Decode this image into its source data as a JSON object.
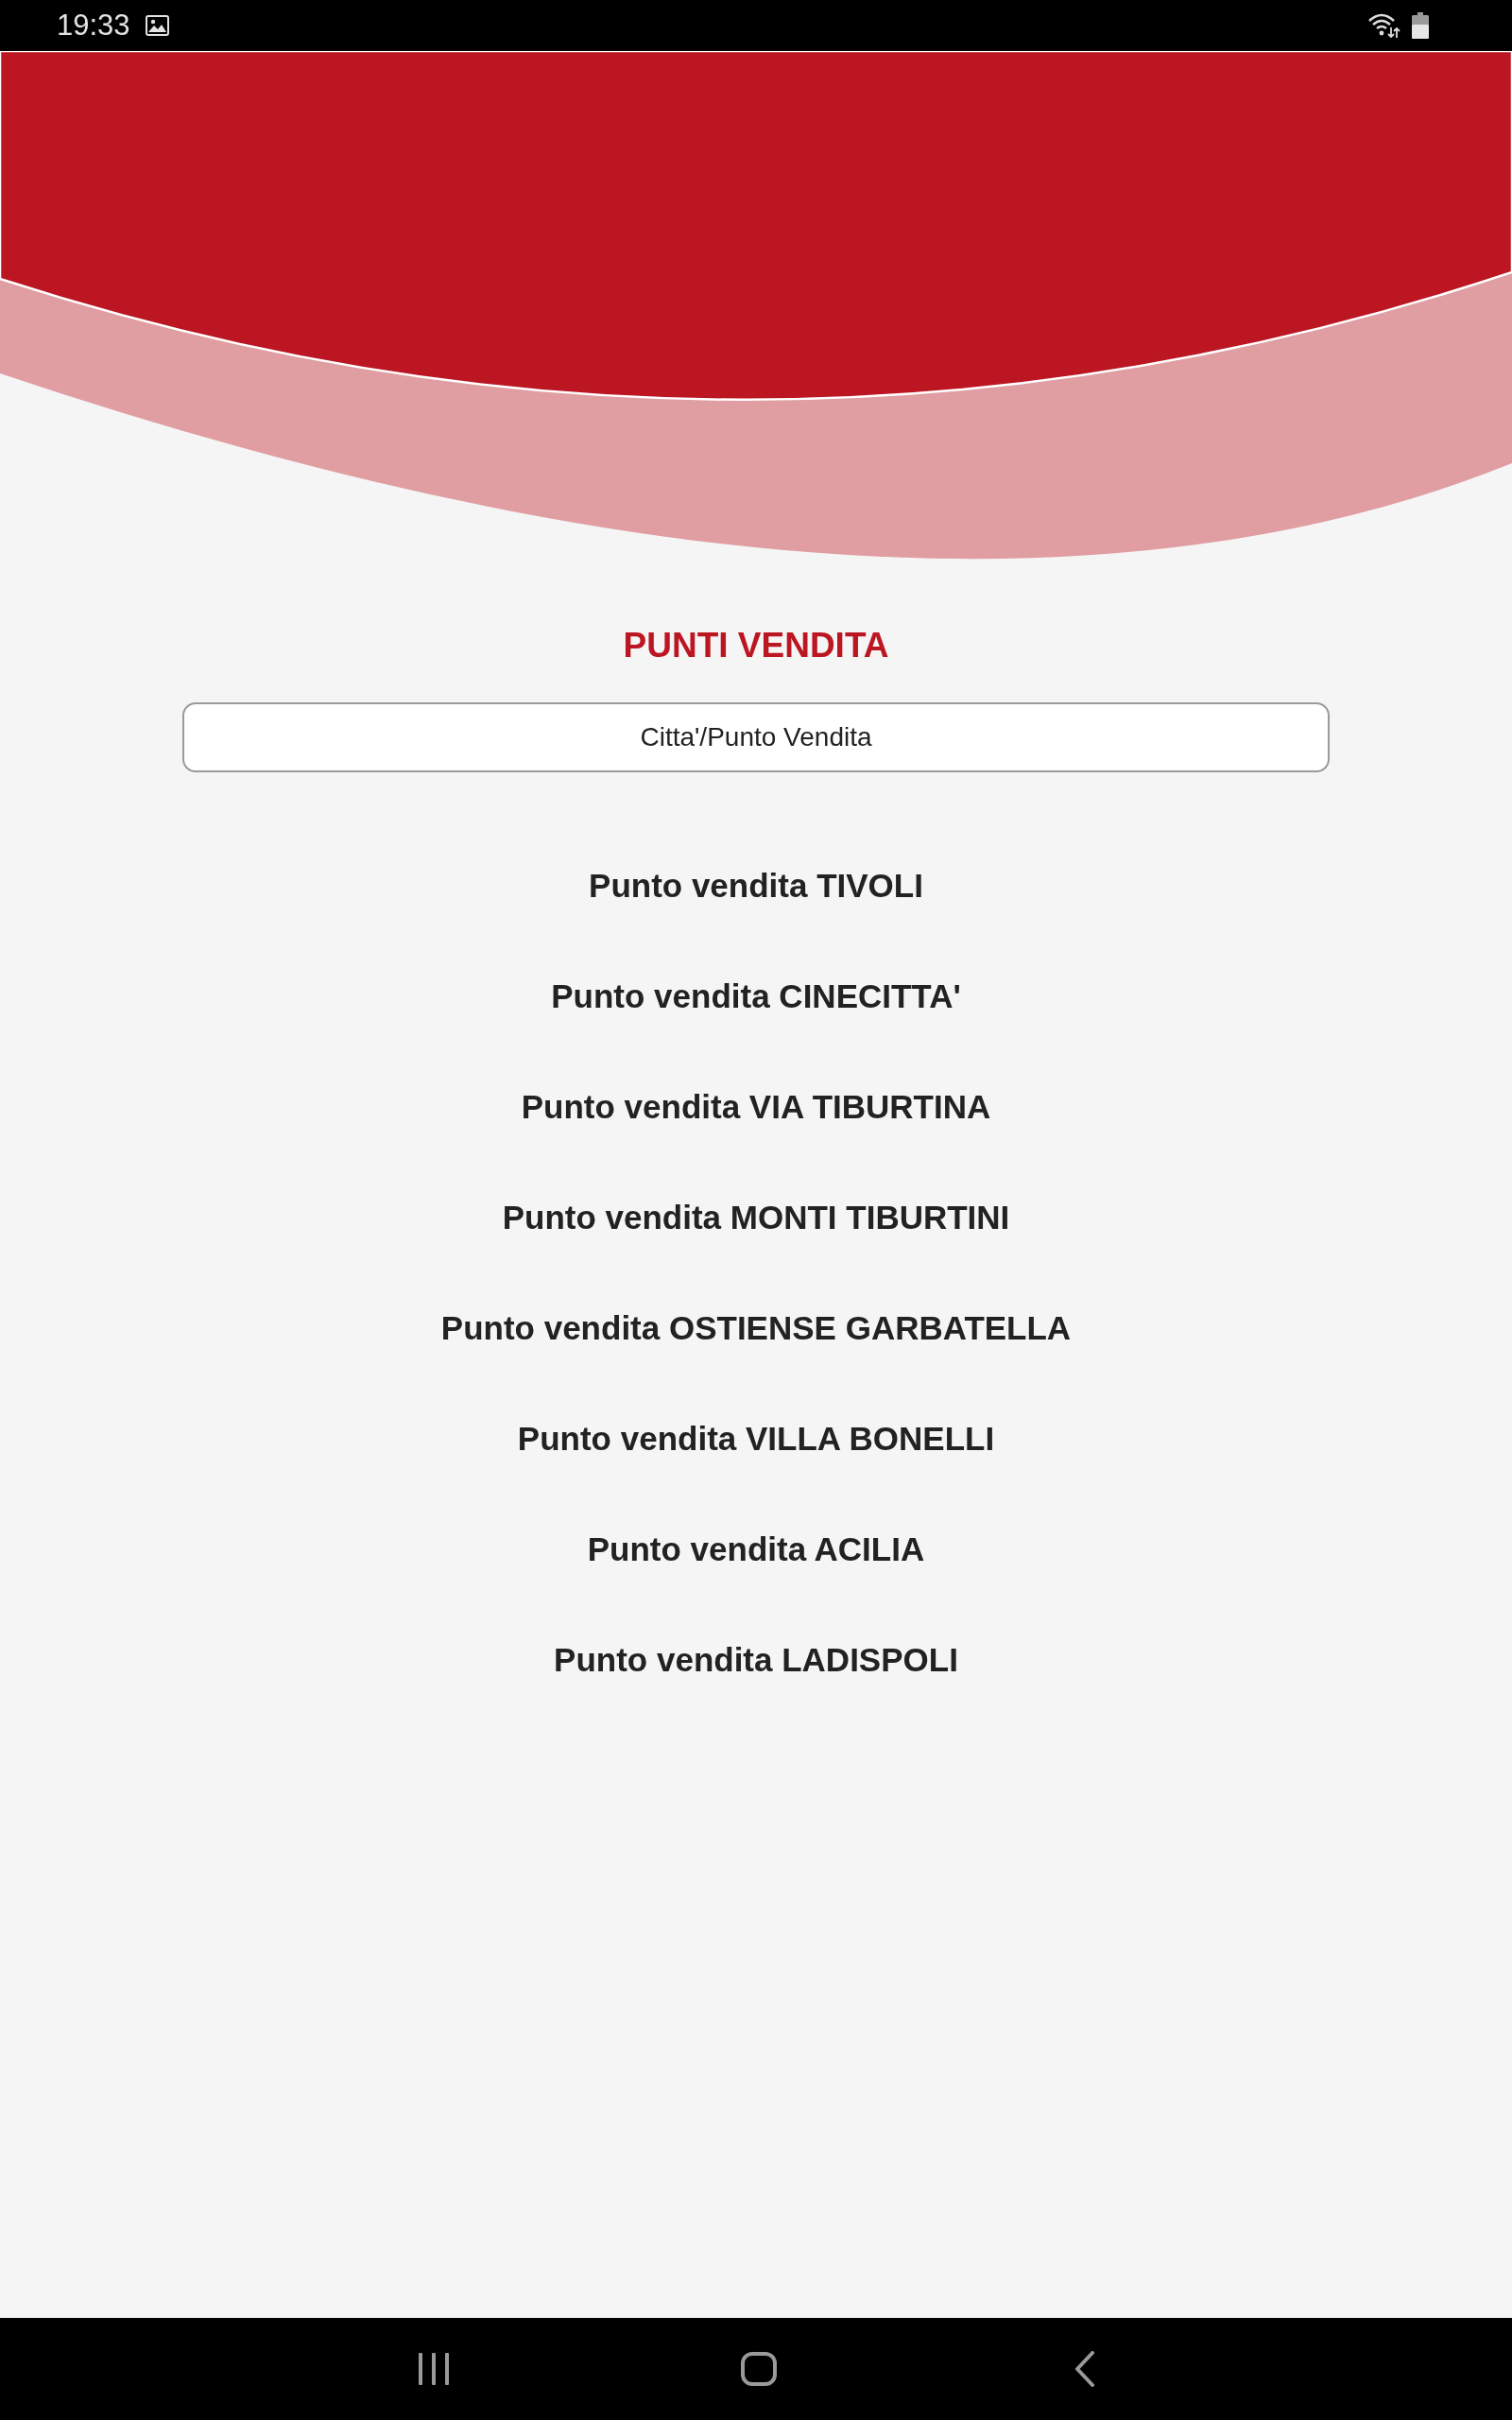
{
  "status_bar": {
    "time": "19:33"
  },
  "title": "PUNTI VENDITA",
  "search": {
    "placeholder": "Citta'/Punto Vendita"
  },
  "stores": [
    "Punto vendita TIVOLI",
    "Punto vendita CINECITTA'",
    "Punto vendita VIA TIBURTINA",
    "Punto vendita MONTI TIBURTINI",
    "Punto vendita OSTIENSE GARBATELLA",
    "Punto vendita VILLA BONELLI",
    "Punto vendita ACILIA",
    "Punto vendita LADISPOLI"
  ]
}
